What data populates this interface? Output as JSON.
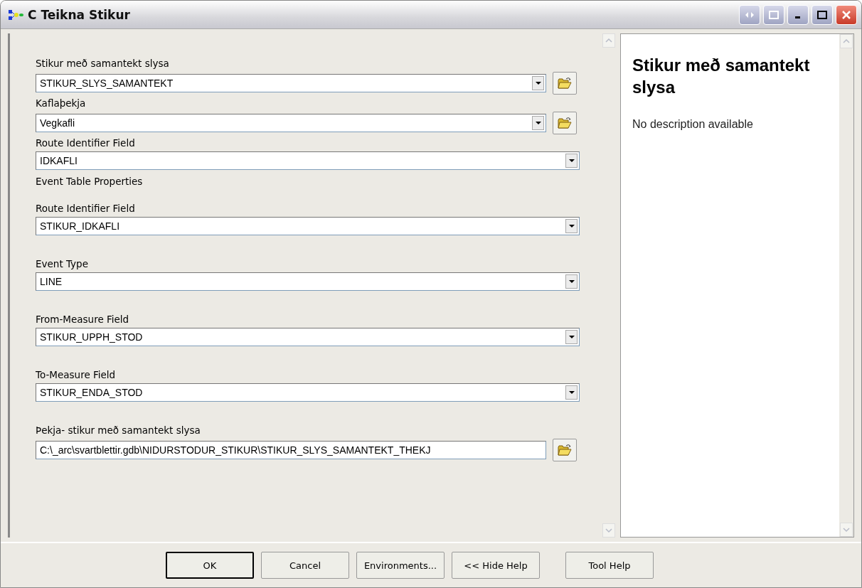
{
  "window": {
    "title": "C Teikna Stikur"
  },
  "parameters": [
    {
      "kind": "field",
      "label": "Stikur með samantekt slysa",
      "value": "STIKUR_SLYS_SAMANTEKT",
      "dropdown": true,
      "browse": true
    },
    {
      "kind": "field",
      "label": "Kaflaþekja",
      "value": "Vegkafli",
      "dropdown": true,
      "browse": true
    },
    {
      "kind": "field",
      "label": "Route Identifier Field",
      "value": "IDKAFLI",
      "dropdown": true,
      "browse": false
    },
    {
      "kind": "heading",
      "label": "Event Table Properties"
    },
    {
      "kind": "field",
      "label": "Route Identifier Field",
      "value": "STIKUR_IDKAFLI",
      "dropdown": true,
      "browse": false
    },
    {
      "kind": "field",
      "label": "Event Type",
      "value": "LINE",
      "dropdown": true,
      "browse": false
    },
    {
      "kind": "field",
      "label": "From-Measure Field",
      "value": "STIKUR_UPPH_STOD",
      "dropdown": true,
      "browse": false
    },
    {
      "kind": "field",
      "label": "To-Measure Field",
      "value": "STIKUR_ENDA_STOD",
      "dropdown": true,
      "browse": false
    },
    {
      "kind": "field",
      "label": "Þekja- stikur með samantekt slysa",
      "value": "C:\\_arc\\svartblettir.gdb\\NIDURSTODUR_STIKUR\\STIKUR_SLYS_SAMANTEKT_THEKJ",
      "dropdown": false,
      "browse": true
    }
  ],
  "help": {
    "title": "Stikur með samantekt slysa",
    "text": "No description available"
  },
  "buttons": [
    {
      "label": "OK",
      "default": true
    },
    {
      "label": "Cancel",
      "default": false
    },
    {
      "label": "Environments...",
      "default": false
    },
    {
      "label": "<< Hide Help",
      "default": false
    },
    {
      "label": "Tool Help",
      "default": false
    }
  ]
}
